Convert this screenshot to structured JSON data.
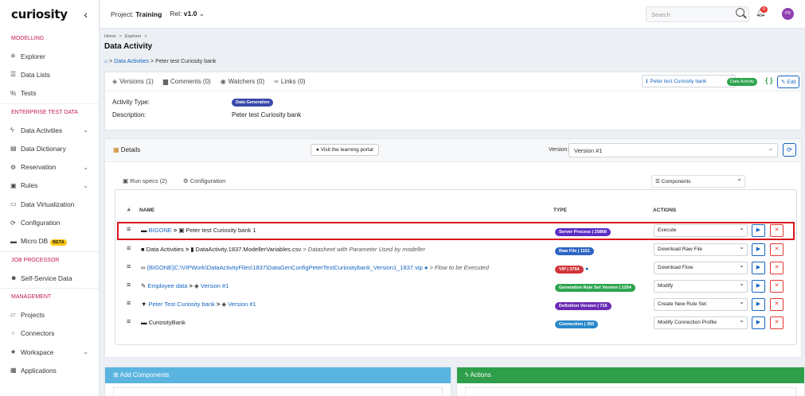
{
  "app": {
    "logo": "curiosity",
    "collapse_icon": "chevron-left-icon"
  },
  "sidebar": {
    "sections": [
      {
        "title": "MODELLING",
        "items": [
          {
            "label": "Explorer",
            "icon": "explorer-icon"
          },
          {
            "label": "Data Lists",
            "icon": "list-icon"
          },
          {
            "label": "Tests",
            "icon": "percent-icon"
          }
        ]
      },
      {
        "title": "ENTERPRISE TEST DATA",
        "items": [
          {
            "label": "Data Activities",
            "icon": "bolt-icon",
            "chevron": true
          },
          {
            "label": "Data Dictionary",
            "icon": "book-icon"
          },
          {
            "label": "Reservation",
            "icon": "gear-icon",
            "chevron": true
          },
          {
            "label": "Rules",
            "icon": "clipboard-icon",
            "chevron": true
          },
          {
            "label": "Data Virtualization",
            "icon": "server-icon"
          },
          {
            "label": "Configuration",
            "icon": "sync-icon"
          },
          {
            "label": "Micro DB",
            "icon": "database-icon",
            "badge": "BETA"
          }
        ]
      },
      {
        "title": "JOB PROCESSOR",
        "items": [
          {
            "label": "Self-Service Data",
            "icon": "users-icon"
          }
        ]
      },
      {
        "title": "MANAGEMENT",
        "items": [
          {
            "label": "Projects",
            "icon": "folder-icon"
          },
          {
            "label": "Connectors",
            "icon": "connector-icon"
          },
          {
            "label": "Workspace",
            "icon": "star-icon",
            "chevron": true
          },
          {
            "label": "Applications",
            "icon": "grid-icon"
          }
        ]
      }
    ]
  },
  "topbar": {
    "project_label": "Project:",
    "project_name": "Training",
    "rel_label": "Rel:",
    "rel_value": "v1.0",
    "search_placeholder": "Search",
    "notification_count": "0",
    "avatar_initials": "PR"
  },
  "breadcrumb": {
    "home": "Home",
    "sep": ">",
    "explorer": "Explorer"
  },
  "page_title": "Data Activity",
  "sub_breadcrumb": {
    "link": "Data Activities",
    "current": "Peter test Curiosity bank"
  },
  "info_tabs": [
    {
      "label": "Peter test Curiosity bank",
      "icon": "info-icon"
    },
    {
      "label": "Versions (1)",
      "icon": "layers-icon"
    },
    {
      "label": "Comments (0)",
      "icon": "comments-icon"
    },
    {
      "label": "Watchers (0)",
      "icon": "eye-icon"
    },
    {
      "label": "Links (0)",
      "icon": "link-icon"
    }
  ],
  "activity_badge": "Data Activity",
  "edit_label": "Edit",
  "fields": {
    "type_label": "Activity Type:",
    "type_value": "Data Generation",
    "desc_label": "Description:",
    "desc_value": "Peter test Curiosity bank"
  },
  "details": {
    "title": "Details",
    "learning_btn": "Visit the learning portal",
    "version_label": "Version:",
    "version_value": "Version #1"
  },
  "component_tabs": [
    {
      "label": "Components",
      "icon": "list-icon"
    },
    {
      "label": "Run specs (2)",
      "icon": "runspec-icon"
    },
    {
      "label": "Configuration",
      "icon": "gear-icon"
    }
  ],
  "table": {
    "headers": {
      "num": "#",
      "name": "NAME",
      "type": "TYPE",
      "actions": "ACTIONS"
    },
    "rows": [
      {
        "name_link": "BIGONE",
        "sep": ">",
        "name_text": "Peter test Curiosity bank 1",
        "type": "Server Process | 25868",
        "type_color": "#5b2ec5",
        "action": "Execute",
        "highlight": true
      },
      {
        "name_link": "Data Activities",
        "sep": ">",
        "name_text": "DataActivity.1837.ModellerVariables.csv",
        "name_extra": "> Datasheet with Parameter Used by modeller",
        "type": "Raw File | 1151",
        "type_color": "#2f64c4",
        "action": "Download Raw File"
      },
      {
        "name_link": "{BIGONE}C:\\VIPWork\\DataActivityFiles\\1837\\DataGenConfigPeterTestCuriositybank_Version1_1837.vip",
        "name_extra": "> Flow to be Executed",
        "type": "VIP | 3754",
        "type_color": "#d2353b",
        "action": "Download Flow"
      },
      {
        "name_link": "Employee data",
        "sep": ">",
        "name_text": "Version #1",
        "type": "Generation Rule Set Version | 1254",
        "type_color": "#2ea44f",
        "action": "Modify"
      },
      {
        "name_link": "Peter Test Curiosity bank",
        "sep": ">",
        "name_text": "Version #1",
        "type": "Definition Version | 716",
        "type_color": "#6a2bb5",
        "action": "Create New Rule Set"
      },
      {
        "name_link": "CuriosityBank",
        "type": "Connection | 350",
        "type_color": "#2a88c9",
        "action": "Modify Connection Profile"
      }
    ]
  },
  "bottom": {
    "add_components": "Add Components",
    "actions": "Actions"
  }
}
